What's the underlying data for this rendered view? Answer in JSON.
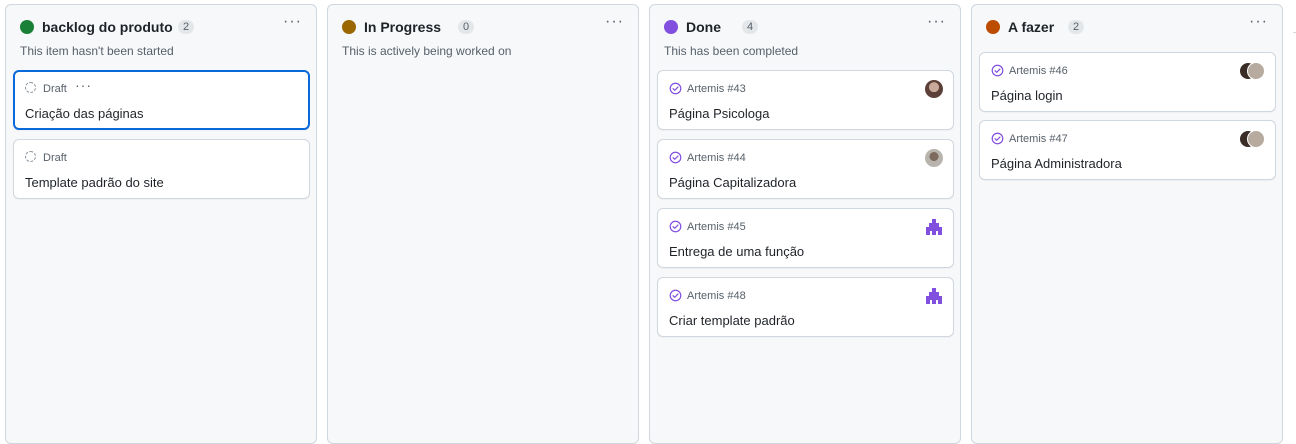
{
  "columns": [
    {
      "title": "backlog do produto",
      "count": "2",
      "description": "This item hasn't been started",
      "color": "#1a7f37",
      "menu_icon": "kebab-horizontal-icon",
      "cards": [
        {
          "meta": "Draft",
          "title": "Criação das páginas",
          "type": "draft",
          "selected": true
        },
        {
          "meta": "Draft",
          "title": "Template padrão do site",
          "type": "draft"
        }
      ]
    },
    {
      "title": "In Progress",
      "count": "0",
      "description": "This is actively being worked on",
      "color": "#9a6700",
      "menu_icon": "kebab-horizontal-icon",
      "cards": []
    },
    {
      "title": "Done",
      "count": "4",
      "description": "This has been completed",
      "color": "#8250df",
      "menu_icon": "kebab-horizontal-icon",
      "cards": [
        {
          "meta": "Artemis #43",
          "title": "Página Psicologa",
          "type": "issue-closed",
          "avatar": "user-avatar-photo"
        },
        {
          "meta": "Artemis #44",
          "title": "Página Capitalizadora",
          "type": "issue-closed",
          "avatar": "user-avatar-photo"
        },
        {
          "meta": "Artemis #45",
          "title": "Entrega de uma função",
          "type": "issue-closed",
          "avatar": "identicon-avatar"
        },
        {
          "meta": "Artemis #48",
          "title": "Criar template padrão",
          "type": "issue-closed",
          "avatar": "identicon-avatar"
        }
      ]
    },
    {
      "title": "A fazer",
      "count": "2",
      "description": "",
      "color": "#bc4c00",
      "menu_icon": "kebab-horizontal-icon",
      "cards": [
        {
          "meta": "Artemis #46",
          "title": "Página login",
          "type": "issue-closed",
          "avatar": "multiple-avatars"
        },
        {
          "meta": "Artemis #47",
          "title": "Página Administradora",
          "type": "issue-closed",
          "avatar": "multiple-avatars"
        }
      ]
    }
  ],
  "colors": {
    "issue_closed": "#8250df",
    "selected_border": "#0969da",
    "identicon": "#8250df"
  }
}
